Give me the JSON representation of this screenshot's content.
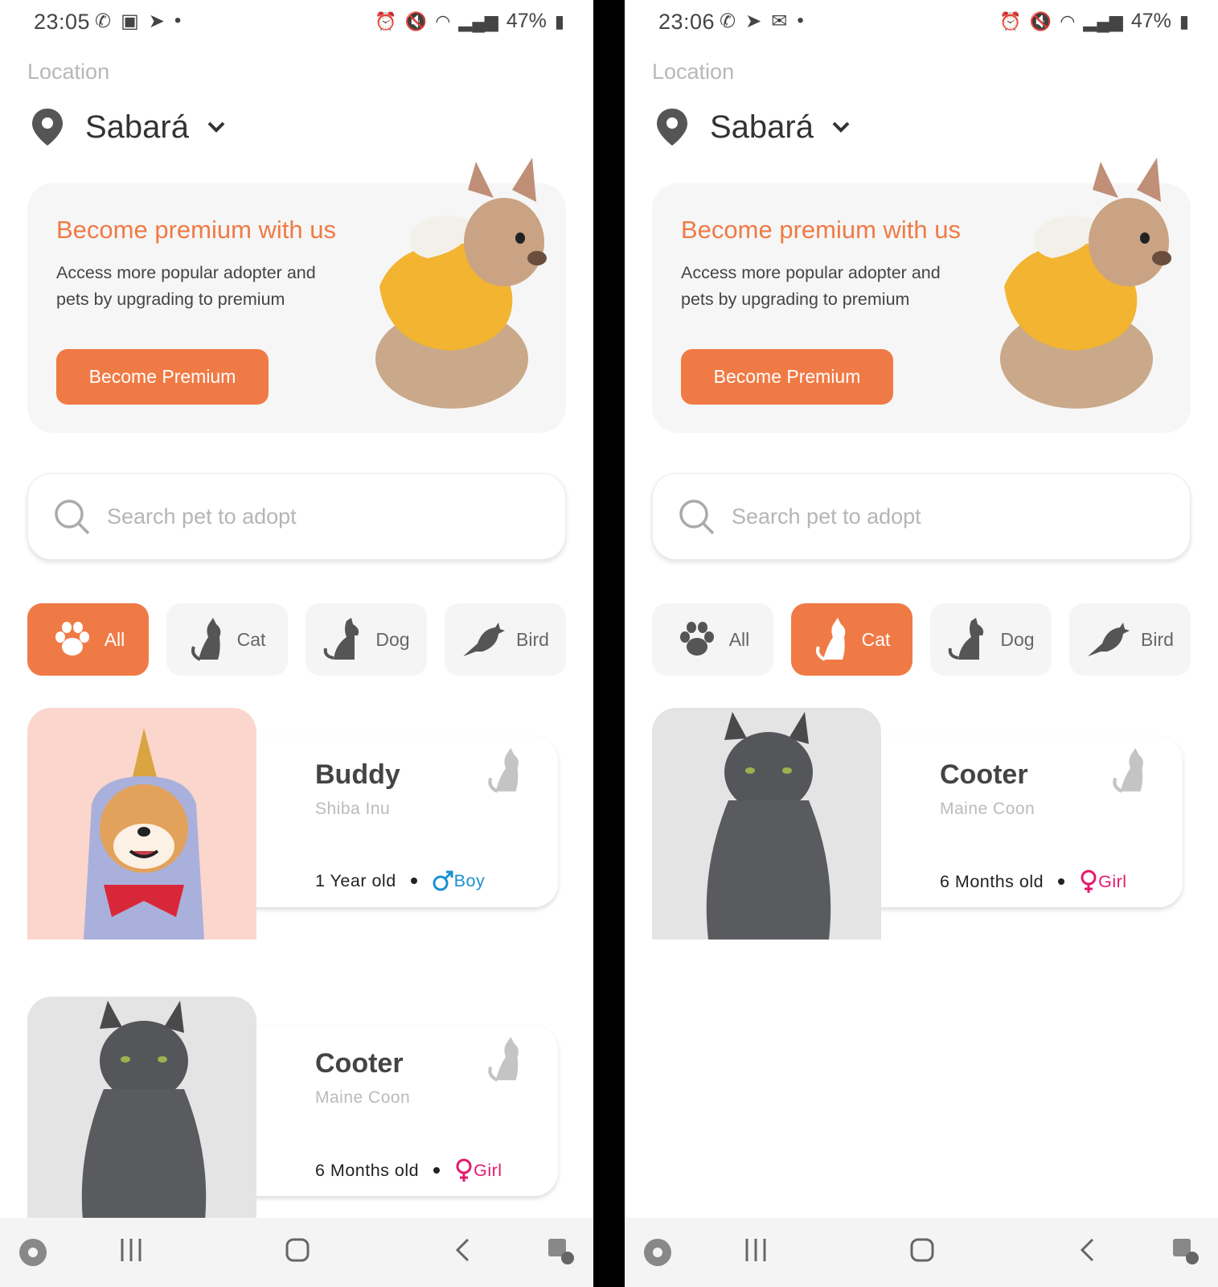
{
  "screens": [
    {
      "status": {
        "time": "23:05",
        "battery": "47%"
      },
      "location": {
        "label": "Location",
        "city": "Sabará"
      },
      "promo": {
        "title": "Become premium with us",
        "description": "Access more popular adopter and pets by upgrading to premium",
        "button": "Become Premium"
      },
      "search": {
        "placeholder": "Search pet to adopt"
      },
      "filters": [
        {
          "label": "All",
          "icon": "paw-icon",
          "active": true
        },
        {
          "label": "Cat",
          "icon": "cat-icon",
          "active": false
        },
        {
          "label": "Dog",
          "icon": "dog-icon",
          "active": false
        },
        {
          "label": "Bird",
          "icon": "bird-icon",
          "active": false
        }
      ],
      "pets": [
        {
          "name": "Buddy",
          "breed": "Shiba Inu",
          "age": "1 Year old",
          "gender": "Boy",
          "photo": "shiba-dog",
          "photo_bg": "#fbd6cc"
        },
        {
          "name": "Cooter",
          "breed": "Maine Coon",
          "age": "6 Months old",
          "gender": "Girl",
          "photo": "grey-cat",
          "photo_bg": "#e4e4e4"
        }
      ]
    },
    {
      "status": {
        "time": "23:06",
        "battery": "47%"
      },
      "location": {
        "label": "Location",
        "city": "Sabará"
      },
      "promo": {
        "title": "Become premium with us",
        "description": "Access more popular adopter and pets by upgrading to premium",
        "button": "Become Premium"
      },
      "search": {
        "placeholder": "Search pet to adopt"
      },
      "filters": [
        {
          "label": "All",
          "icon": "paw-icon",
          "active": false
        },
        {
          "label": "Cat",
          "icon": "cat-icon",
          "active": true
        },
        {
          "label": "Dog",
          "icon": "dog-icon",
          "active": false
        },
        {
          "label": "Bird",
          "icon": "bird-icon",
          "active": false
        }
      ],
      "pets": [
        {
          "name": "Cooter",
          "breed": "Maine Coon",
          "age": "6 Months old",
          "gender": "Girl",
          "photo": "grey-cat",
          "photo_bg": "#e4e4e4"
        }
      ]
    }
  ],
  "theme": {
    "accent": "#f07a45",
    "boy": "#1a8fd1",
    "girl": "#e3196e"
  }
}
